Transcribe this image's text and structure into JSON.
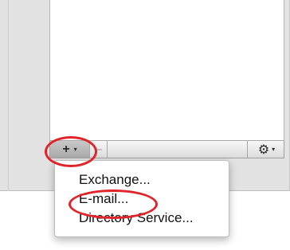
{
  "toolbar": {
    "add_icon": "+",
    "add_caret": "▾",
    "remove_icon": "–",
    "action_icon": "⚙",
    "action_caret": "▾"
  },
  "menu": {
    "items": [
      {
        "label": "Exchange..."
      },
      {
        "label": "E-mail..."
      },
      {
        "label": "Directory Service..."
      }
    ]
  },
  "annotation": {
    "highlight_color": "#e0242a"
  }
}
